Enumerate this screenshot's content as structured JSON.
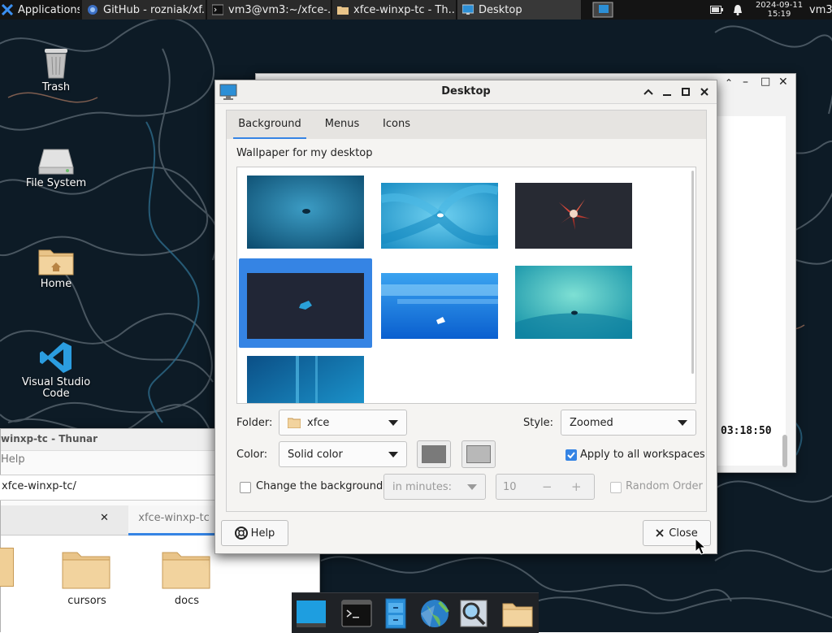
{
  "panel": {
    "applications_label": "Applications",
    "tasks": [
      {
        "label": "GitHub - rozniak/xf..."
      },
      {
        "label": "vm3@vm3:~/xfce-..."
      },
      {
        "label": "xfce-winxp-tc - Th..."
      },
      {
        "label": "Desktop"
      }
    ],
    "date": "2024-09-11",
    "time": "15:19",
    "user": "vm3"
  },
  "desktop_icons": [
    {
      "label": "Trash",
      "icon": "trash-icon"
    },
    {
      "label": "File System",
      "icon": "drive-icon"
    },
    {
      "label": "Home",
      "icon": "home-folder-icon"
    },
    {
      "label": "Visual Studio Code",
      "icon": "vscode-icon"
    }
  ],
  "background_window": {
    "clock_text": "03:18:50"
  },
  "thunar": {
    "title": "winxp-tc - Thunar",
    "menu": "Help",
    "path": "xfce-winxp-tc/",
    "tab_active": "xfce-winxp-tc",
    "folders": [
      "cursors",
      "docs"
    ]
  },
  "dialog": {
    "title": "Desktop",
    "tabs": [
      "Background",
      "Menus",
      "Icons"
    ],
    "wallpaper_label": "Wallpaper for my desktop",
    "folder_label": "Folder:",
    "folder_value": "xfce",
    "style_label": "Style:",
    "style_value": "Zoomed",
    "color_label": "Color:",
    "color_value": "Solid color",
    "colors": {
      "primary": "#7a7a7a",
      "secondary": "#b8b8b8",
      "accent": "#3584e4"
    },
    "apply_all_label": "Apply to all workspaces",
    "apply_all_checked": true,
    "change_bg_label": "Change the background",
    "change_bg_checked": false,
    "interval_value": "in minutes:",
    "interval_number": "10",
    "random_order_label": "Random Order",
    "help_label": "Help",
    "close_label": "Close"
  }
}
